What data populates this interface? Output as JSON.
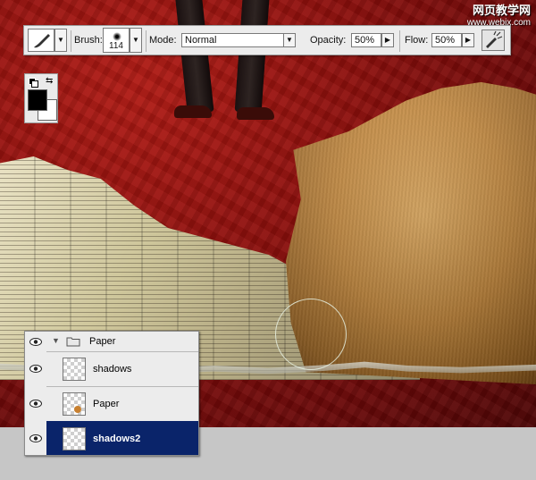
{
  "watermark": {
    "line1": "网页教学网",
    "line2": "www.webjx.com"
  },
  "toolbar": {
    "brush_label": "Brush:",
    "brush_size": "114",
    "mode_label": "Mode:",
    "mode_value": "Normal",
    "opacity_label": "Opacity:",
    "opacity_value": "50%",
    "flow_label": "Flow:",
    "flow_value": "50%"
  },
  "colors": {
    "foreground": "#000000",
    "background": "#ffffff",
    "selection": "#0a246a"
  },
  "layers": {
    "group_name": "Paper",
    "items": [
      {
        "name": "shadows",
        "selected": false
      },
      {
        "name": "Paper",
        "selected": false
      },
      {
        "name": "shadows2",
        "selected": true
      }
    ]
  }
}
